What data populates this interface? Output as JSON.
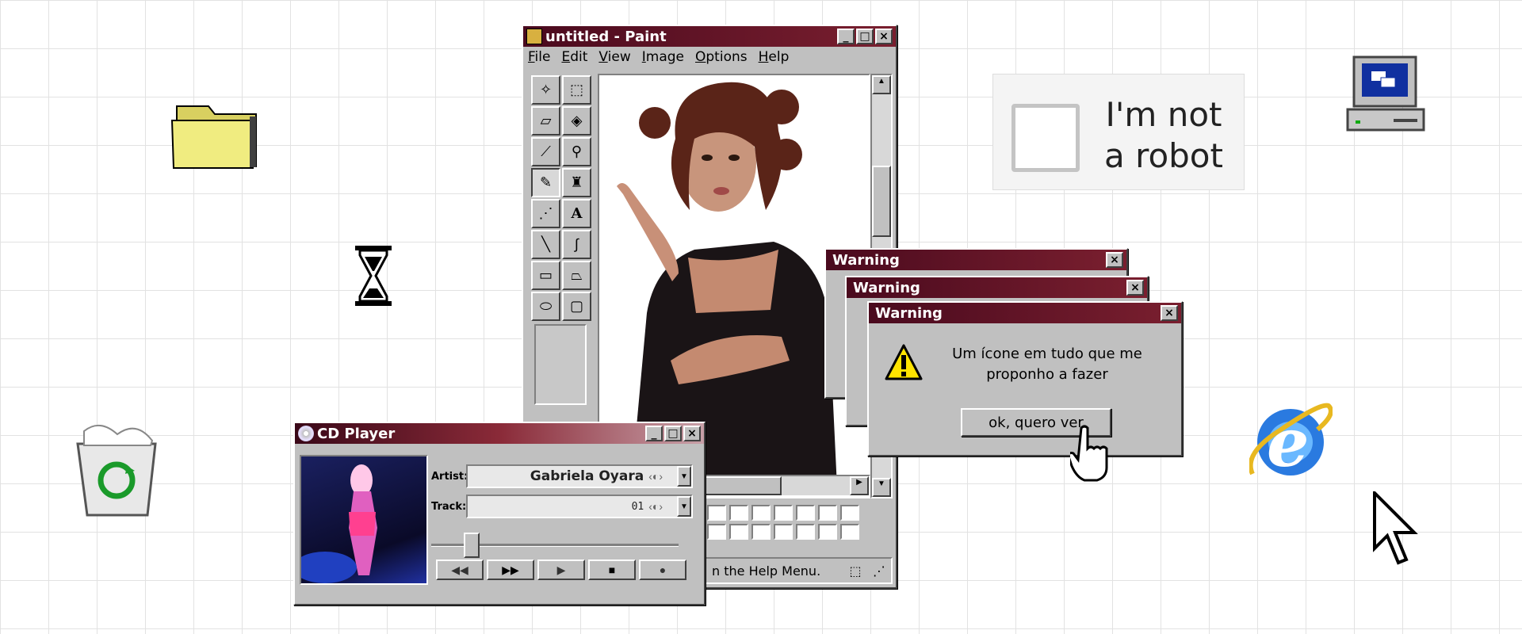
{
  "desktop": {
    "icons": [
      "folder-icon",
      "hourglass-icon",
      "recycle-bin-icon",
      "my-computer-icon",
      "internet-explorer-icon",
      "arrow-cursor-icon"
    ]
  },
  "captcha": {
    "label": "I'm not a robot"
  },
  "paint": {
    "title": "untitled - Paint",
    "menu": [
      "File",
      "Edit",
      "View",
      "Image",
      "Options",
      "Help"
    ],
    "status": "n the Help Menu."
  },
  "warnings": [
    {
      "title": "Warning"
    },
    {
      "title": "Warning"
    },
    {
      "title": "Warning",
      "message_line1": "Um ícone em tudo que me",
      "message_line2": "proponho a fazer",
      "button": "ok, quero ver"
    }
  ],
  "warning_back_title": "Warning",
  "warning_mid_title": "Warning",
  "cd_player": {
    "title": "CD Player",
    "artist_label": "Artist:",
    "artist_value": "Gabriela Oyara",
    "track_label": "Track:",
    "track_value": "01",
    "position": 0.14
  },
  "colors": {
    "titlebar": "#6a1424",
    "face": "#c0c0c0"
  }
}
